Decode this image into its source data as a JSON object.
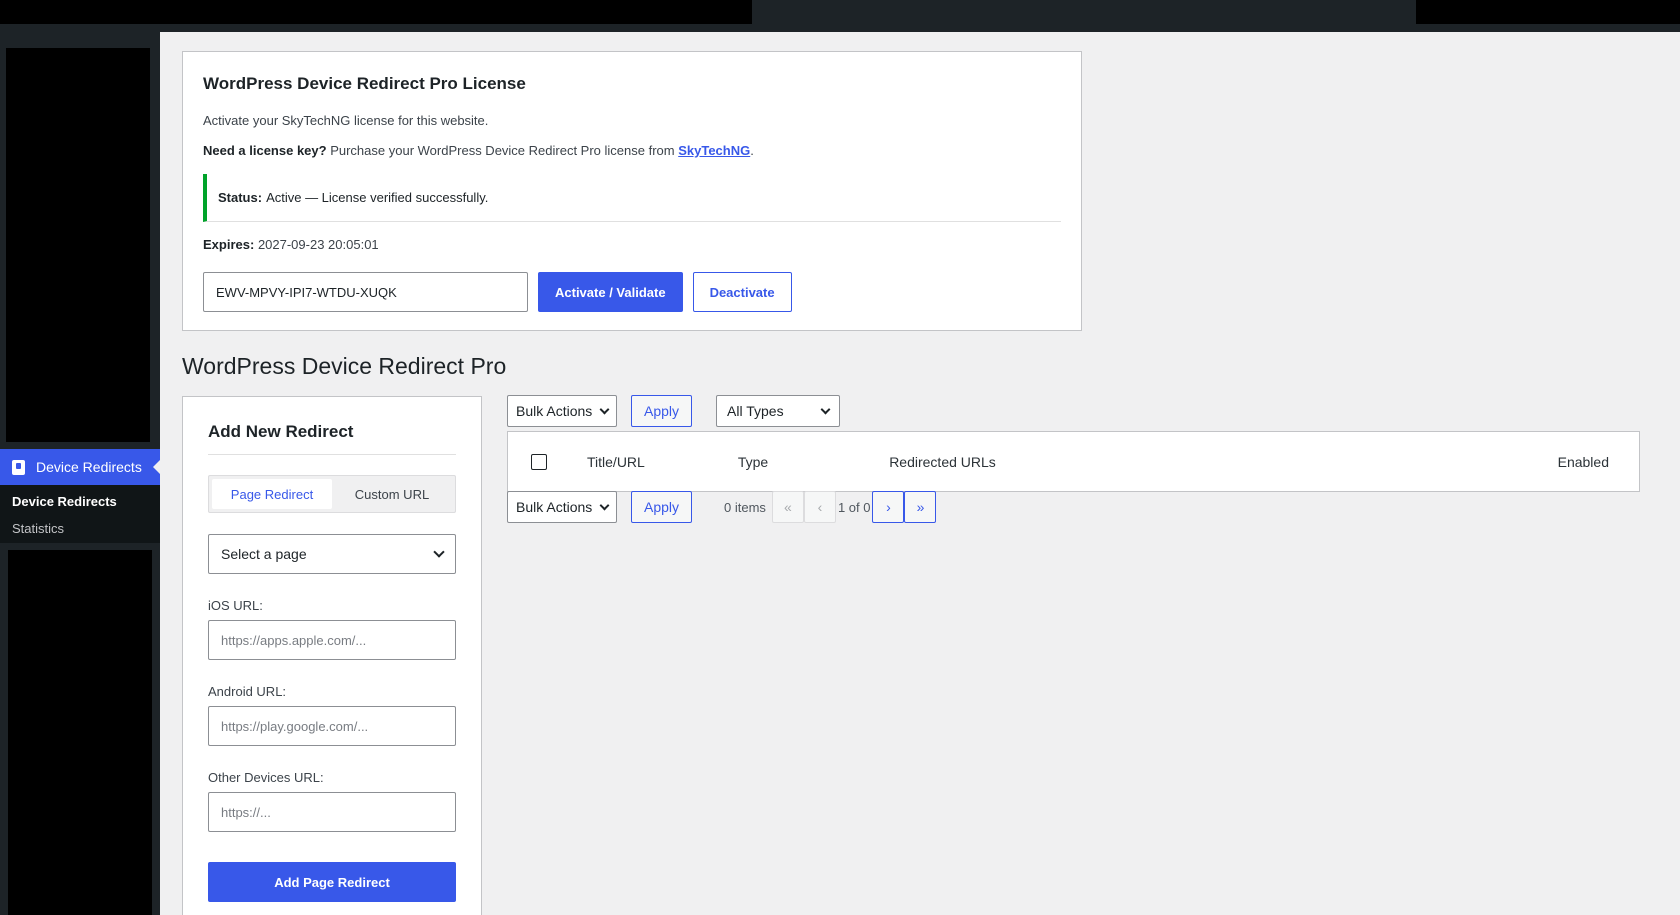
{
  "sidebar": {
    "active_item": "Device Redirects",
    "sub_items": [
      "Device Redirects",
      "Statistics"
    ]
  },
  "license": {
    "title": "WordPress Device Redirect Pro License",
    "intro": "Activate your SkyTechNG license for this website.",
    "need_key_bold": "Need a license key?",
    "need_key_text": "Purchase your WordPress Device Redirect Pro license from",
    "link_text": "SkyTechNG",
    "period": ".",
    "status_label": "Status:",
    "status_text": "Active — License verified successfully.",
    "expires_label": "Expires:",
    "expires_value": "2027-09-23 20:05:01",
    "key_value": "EWV-MPVY-IPI7-WTDU-XUQK",
    "activate_label": "Activate / Validate",
    "deactivate_label": "Deactivate"
  },
  "page_title": "WordPress Device Redirect Pro",
  "add_form": {
    "title": "Add New Redirect",
    "tabs": [
      "Page Redirect",
      "Custom URL"
    ],
    "active_tab": "Page Redirect",
    "page_select": "Select a page",
    "ios_label": "iOS URL:",
    "ios_placeholder": "https://apps.apple.com/...",
    "android_label": "Android URL:",
    "android_placeholder": "https://play.google.com/...",
    "other_label": "Other Devices URL:",
    "other_placeholder": "https://...",
    "submit_label": "Add Page Redirect"
  },
  "table": {
    "bulk_actions": "Bulk Actions",
    "apply": "Apply",
    "type_filter": "All Types",
    "columns": [
      "Title/URL",
      "Type",
      "Redirected URLs",
      "Enabled"
    ],
    "items_count": "0 items",
    "page_info": "1 of 0",
    "first": "«",
    "prev": "‹",
    "next": "›",
    "last": "»"
  },
  "colors": {
    "accent": "#3858e9",
    "success": "#00a32a",
    "sidebar_bg": "#1d2327"
  }
}
